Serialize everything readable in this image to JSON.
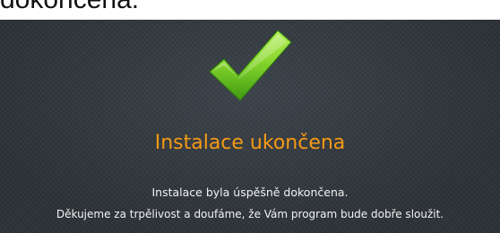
{
  "top_fragment": "dokončena.",
  "dialog": {
    "icon": "checkmark-icon",
    "colors": {
      "background": "#33393f",
      "title": "#f59a16",
      "text": "#f2f2f2",
      "check_light": "#9ae13a",
      "check_dark": "#3f9a12"
    },
    "title": "Instalace ukončena",
    "message_line_1": "Instalace byla úspěšně dokončena.",
    "message_line_2": "Děkujeme za trpělivost a doufáme, že Vám program bude dobře sloužit."
  }
}
